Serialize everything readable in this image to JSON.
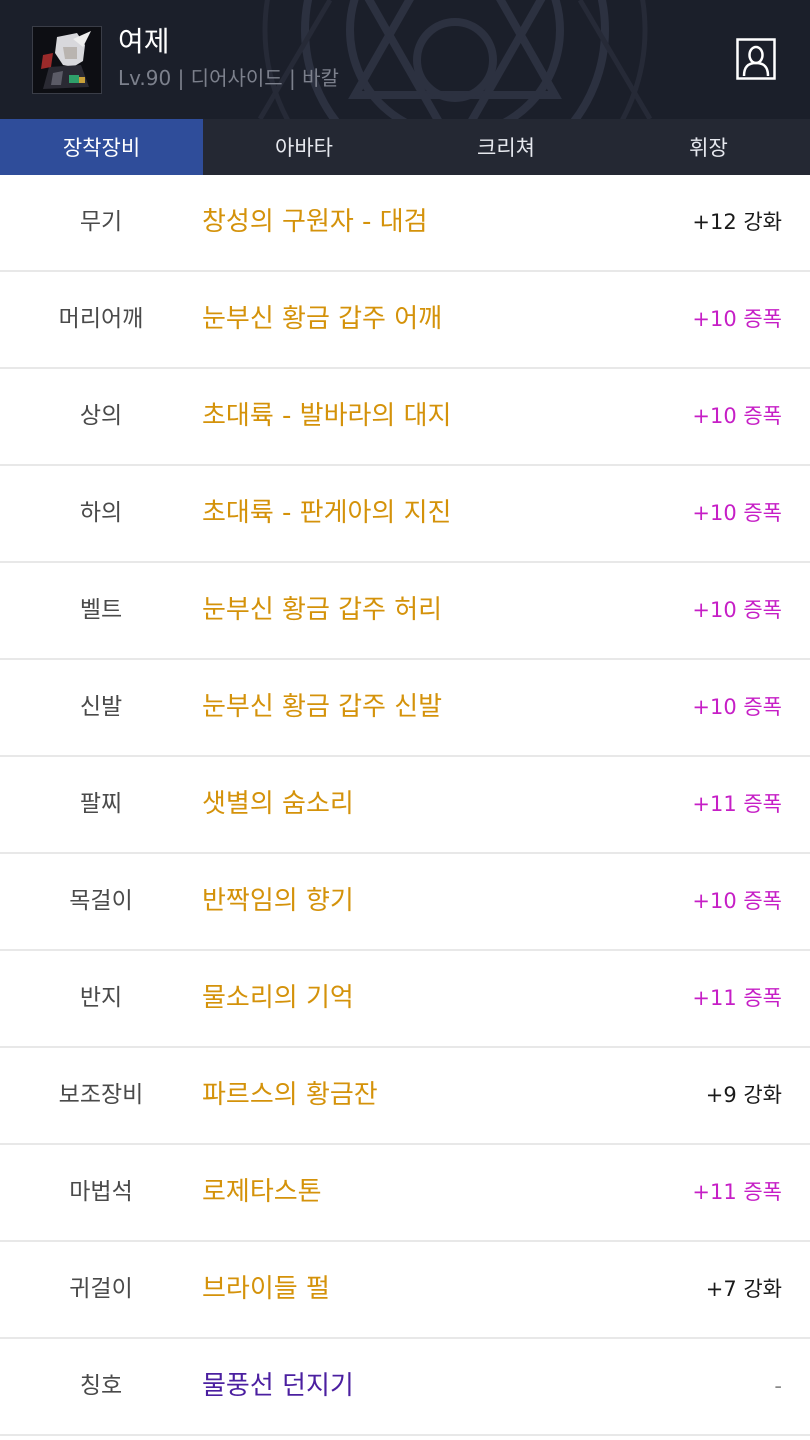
{
  "header": {
    "character_name": "여제",
    "character_info": "Lv.90 | 디어사이드 | 바칼",
    "avatar_icon": "character-portrait-icon",
    "profile_icon": "person-icon",
    "background_color": "#1b1f2a"
  },
  "tabs": [
    {
      "label": "장착장비",
      "active": true
    },
    {
      "label": "아바타",
      "active": false
    },
    {
      "label": "크리쳐",
      "active": false
    },
    {
      "label": "휘장",
      "active": false
    }
  ],
  "colors": {
    "epic": "#d4920a",
    "title_item": "#4b1fa0",
    "amplify": "#c61fc6",
    "reinforce": "#1a1a1a",
    "tab_active": "#2f4d9a"
  },
  "equipment": [
    {
      "slot": "무기",
      "name": "창성의 구원자 - 대검",
      "upgrade": "+12 강화",
      "rarity": "epic",
      "upgrade_type": "reinforce"
    },
    {
      "slot": "머리어깨",
      "name": "눈부신 황금 갑주 어깨",
      "upgrade": "+10 증폭",
      "rarity": "epic",
      "upgrade_type": "amplify"
    },
    {
      "slot": "상의",
      "name": "초대륙 - 발바라의 대지",
      "upgrade": "+10 증폭",
      "rarity": "epic",
      "upgrade_type": "amplify"
    },
    {
      "slot": "하의",
      "name": "초대륙 - 판게아의 지진",
      "upgrade": "+10 증폭",
      "rarity": "epic",
      "upgrade_type": "amplify"
    },
    {
      "slot": "벨트",
      "name": "눈부신 황금 갑주 허리",
      "upgrade": "+10 증폭",
      "rarity": "epic",
      "upgrade_type": "amplify"
    },
    {
      "slot": "신발",
      "name": "눈부신 황금 갑주 신발",
      "upgrade": "+10 증폭",
      "rarity": "epic",
      "upgrade_type": "amplify"
    },
    {
      "slot": "팔찌",
      "name": "샛별의 숨소리",
      "upgrade": "+11 증폭",
      "rarity": "epic",
      "upgrade_type": "amplify"
    },
    {
      "slot": "목걸이",
      "name": "반짝임의 향기",
      "upgrade": "+10 증폭",
      "rarity": "epic",
      "upgrade_type": "amplify"
    },
    {
      "slot": "반지",
      "name": "물소리의 기억",
      "upgrade": "+11 증폭",
      "rarity": "epic",
      "upgrade_type": "amplify"
    },
    {
      "slot": "보조장비",
      "name": "파르스의 황금잔",
      "upgrade": "+9 강화",
      "rarity": "epic",
      "upgrade_type": "reinforce"
    },
    {
      "slot": "마법석",
      "name": "로제타스톤",
      "upgrade": "+11 증폭",
      "rarity": "epic",
      "upgrade_type": "amplify"
    },
    {
      "slot": "귀걸이",
      "name": "브라이들 펄",
      "upgrade": "+7 강화",
      "rarity": "epic",
      "upgrade_type": "reinforce"
    },
    {
      "slot": "칭호",
      "name": "물풍선 던지기",
      "upgrade": "-",
      "rarity": "title_item",
      "upgrade_type": "none"
    }
  ]
}
